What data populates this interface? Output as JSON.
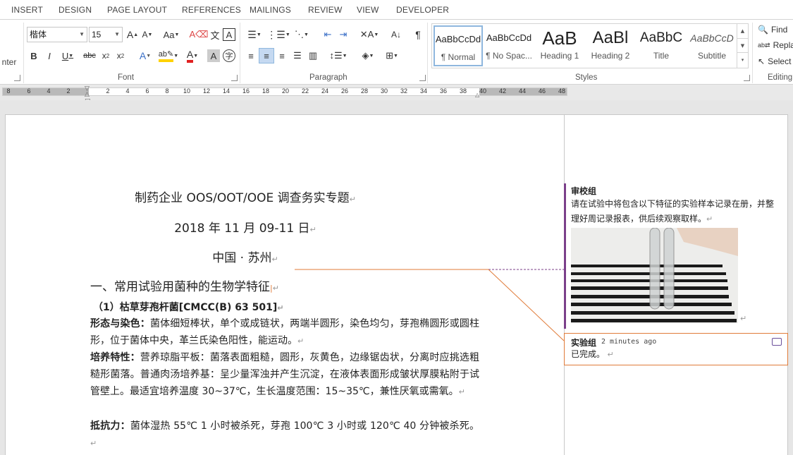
{
  "tabs": [
    "INSERT",
    "DESIGN",
    "PAGE LAYOUT",
    "REFERENCES",
    "MAILINGS",
    "REVIEW",
    "VIEW",
    "DEVELOPER"
  ],
  "ribbon": {
    "clipboard_tail": "nter",
    "font": {
      "family": "楷体",
      "size": "15",
      "group_label": "Font"
    },
    "paragraph": {
      "group_label": "Paragraph"
    },
    "styles": {
      "group_label": "Styles",
      "items": [
        {
          "preview": "AaBbCcDd",
          "name": "¶ Normal"
        },
        {
          "preview": "AaBbCcDd",
          "name": "¶ No Spac..."
        },
        {
          "preview": "AaB",
          "name": "Heading 1"
        },
        {
          "preview": "AaBl",
          "name": "Heading 2"
        },
        {
          "preview": "AaBbC",
          "name": "Title"
        },
        {
          "preview": "AaBbCcD",
          "name": "Subtitle"
        }
      ]
    },
    "editing": {
      "group_label": "Editing",
      "find": "Find",
      "replace": "Replac",
      "select": "Select"
    }
  },
  "ruler": {
    "left_ticks": [
      "8",
      "6",
      "4",
      "2"
    ],
    "right_ticks": [
      "2",
      "4",
      "6",
      "8",
      "10",
      "12",
      "14",
      "16",
      "18",
      "20",
      "22",
      "24",
      "26",
      "28",
      "30",
      "32",
      "34",
      "36",
      "38",
      "40",
      "42",
      "44",
      "46",
      "48"
    ]
  },
  "document": {
    "title": "制药企业 OOS/OOT/OOE 调查务实专题",
    "date": "2018 年 11 月 09-11 日",
    "place": "中国 · 苏州",
    "heading1": "一、常用试验用菌种的生物学特征",
    "heading2": "（1）枯草芽孢杆菌[CMCC(B) 63 501]",
    "p1_label": "形态与染色：",
    "p1_text": "菌体细短棒状，单个或成链状，两端半圆形，染色均匀，芽孢椭圆形或圆柱形，位于菌体中央，革兰氏染色阳性，能运动。",
    "p2_label": "培养特性：",
    "p2_text": "营养琼脂平板：菌落表面粗糙，圆形，灰黄色，边缘锯齿状，分离时应挑选粗糙形菌落。普通肉汤培养基：呈少量浑浊并产生沉淀，在液体表面形成皱状厚膜粘附于试管壁上。最适宜培养温度 30~37℃，生长温度范围：15~35℃，兼性厌氧或需氧。",
    "p3_label": "抵抗力：",
    "p3_text": "菌体湿热 55℃ 1 小时被杀死，芽孢 100℃ 3 小时或 120℃ 40 分钟被杀死。"
  },
  "comments": [
    {
      "author": "审校组",
      "text": "请在试验中将包含以下特征的实验样本记录在册，并整理好周记录报表，供后续观察取样。",
      "time": ""
    },
    {
      "author": "实验组",
      "time": "2 minutes ago",
      "text": "已完成。"
    }
  ],
  "colors": {
    "comment_bar": "#7b3f8a",
    "reply_border": "#e07b39",
    "highlight": "#ffd200",
    "font_color": "#e02020"
  },
  "icons": [
    "find-icon",
    "replace-icon",
    "select-icon",
    "reply-icon"
  ]
}
